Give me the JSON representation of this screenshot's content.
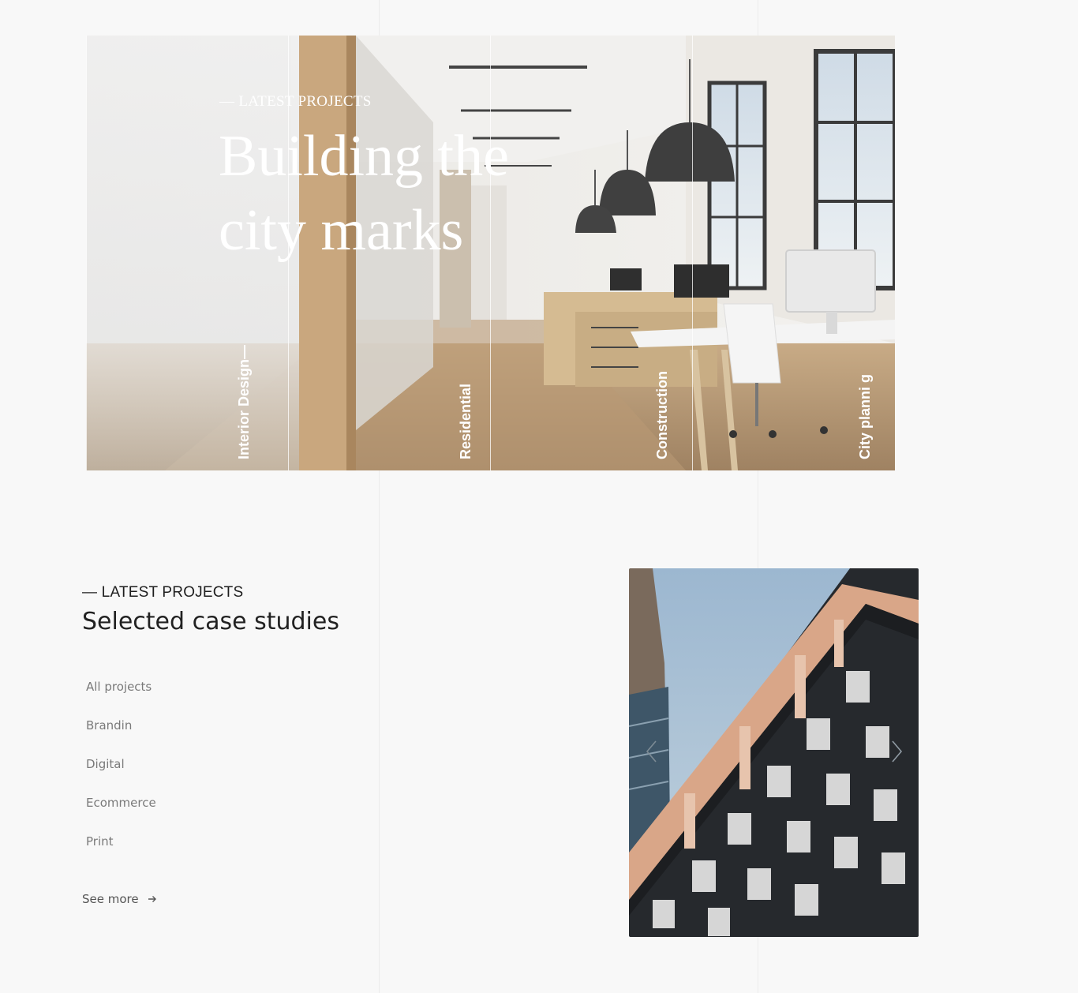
{
  "hero": {
    "eyebrow": "— LATEST PROJECTS",
    "headline": "Building the city marks",
    "categories": [
      "Interior Design—",
      "Residential",
      "Construction",
      "City planni g"
    ]
  },
  "section": {
    "eyebrow": "— LATEST PROJECTS",
    "title": "Selected case studies",
    "filters": [
      "All projects",
      "Brandin",
      "Digital",
      "Ecommerce",
      "Print"
    ],
    "see_more": "See more"
  },
  "icons": {
    "see_more": "arrow-right-icon",
    "prev": "chevron-left-icon",
    "next": "chevron-right-icon"
  }
}
